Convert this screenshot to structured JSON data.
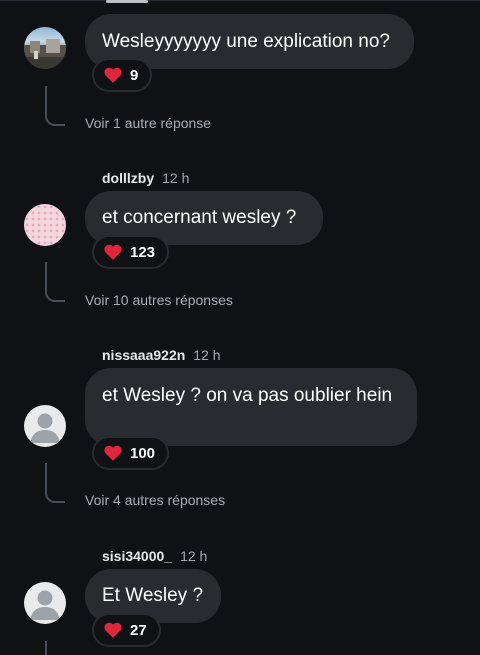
{
  "comments": [
    {
      "text": "Wesleyyyyyyy une explication no?",
      "likes": "9",
      "more": "Voir 1 autre réponse",
      "avatar": "photo"
    },
    {
      "username": "dolllzby",
      "time": "12 h",
      "text": "et concernant wesley ?",
      "likes": "123",
      "more": "Voir 10 autres réponses",
      "avatar": "pink-dots"
    },
    {
      "username": "nissaaa922n",
      "time": "12 h",
      "text": "et Wesley ? on va pas oublier hein",
      "likes": "100",
      "more": "Voir 4 autres réponses",
      "avatar": "default-user"
    },
    {
      "username": "sisi34000_",
      "time": "12 h",
      "text": "Et Wesley ?",
      "likes": "27",
      "avatar": "default-user"
    }
  ],
  "icons": {
    "like": "heart-icon",
    "avatar_default": "user-silhouette-icon"
  },
  "colors": {
    "background": "#0f1115",
    "bubble": "#2a2b30",
    "heart": "#e0263b"
  }
}
